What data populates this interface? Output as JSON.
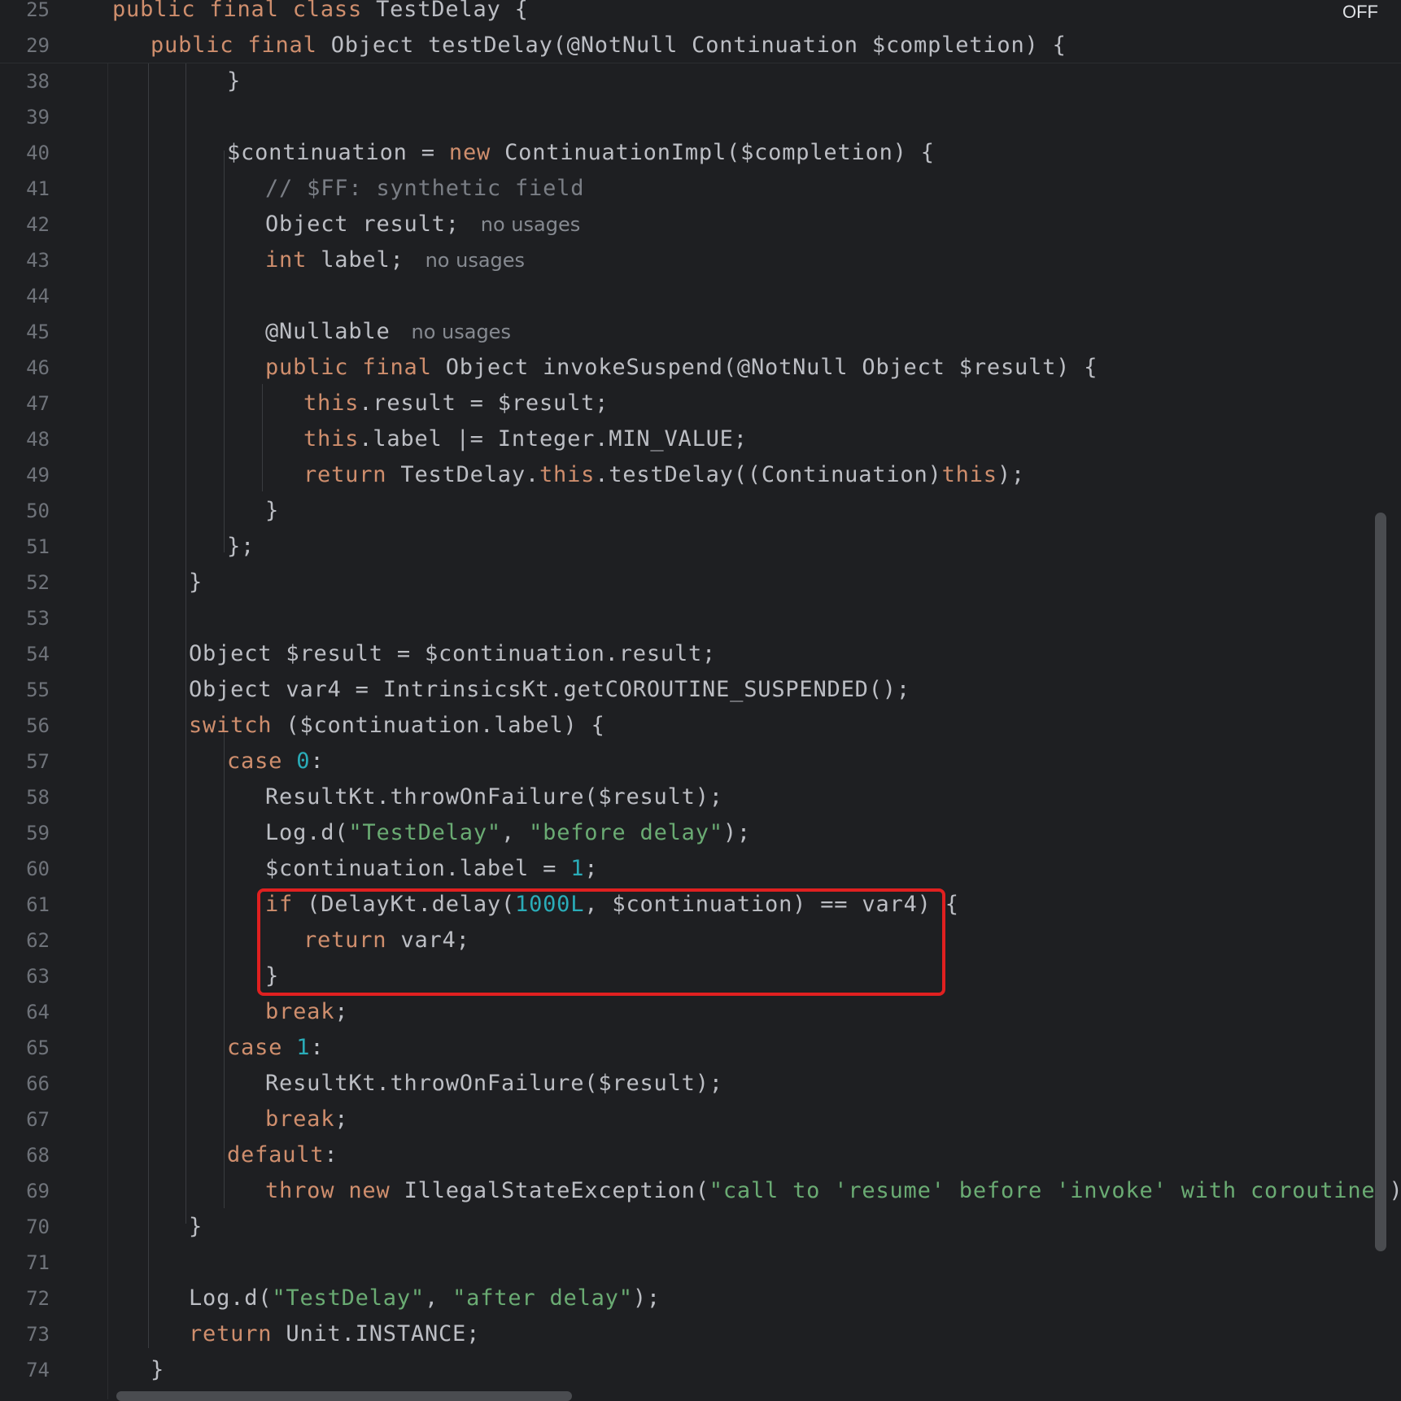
{
  "status_indicator": "OFF",
  "lines": [
    {
      "num": "25",
      "indent": 0,
      "tokens": [
        {
          "t": "public final class ",
          "c": "kw"
        },
        {
          "t": "TestDelay {",
          "c": "plain"
        }
      ]
    },
    {
      "num": "29",
      "indent": 1,
      "tokens": [
        {
          "t": "public final ",
          "c": "kw"
        },
        {
          "t": "Object testDelay(@NotNull Continuation $completion) {",
          "c": "plain"
        }
      ]
    },
    {
      "num": "38",
      "indent": 3,
      "tokens": [
        {
          "t": "}",
          "c": "plain"
        }
      ]
    },
    {
      "num": "39",
      "indent": 0,
      "tokens": []
    },
    {
      "num": "40",
      "indent": 3,
      "tokens": [
        {
          "t": "$continuation = ",
          "c": "plain"
        },
        {
          "t": "new ",
          "c": "kw"
        },
        {
          "t": "ContinuationImpl($completion) {",
          "c": "plain"
        }
      ]
    },
    {
      "num": "41",
      "indent": 4,
      "tokens": [
        {
          "t": "// $FF: synthetic field",
          "c": "cmt"
        }
      ]
    },
    {
      "num": "42",
      "indent": 4,
      "tokens": [
        {
          "t": "Object result;",
          "c": "plain"
        }
      ],
      "hint": "no usages"
    },
    {
      "num": "43",
      "indent": 4,
      "tokens": [
        {
          "t": "int ",
          "c": "kw"
        },
        {
          "t": "label;",
          "c": "plain"
        }
      ],
      "hint": "no usages"
    },
    {
      "num": "44",
      "indent": 0,
      "tokens": []
    },
    {
      "num": "45",
      "indent": 4,
      "tokens": [
        {
          "t": "@Nullable",
          "c": "plain"
        }
      ],
      "hint": "no usages"
    },
    {
      "num": "46",
      "indent": 4,
      "tokens": [
        {
          "t": "public final ",
          "c": "kw"
        },
        {
          "t": "Object invokeSuspend(@NotNull Object $result) {",
          "c": "plain"
        }
      ]
    },
    {
      "num": "47",
      "indent": 5,
      "tokens": [
        {
          "t": "this",
          "c": "kw"
        },
        {
          "t": ".result = $result;",
          "c": "plain"
        }
      ]
    },
    {
      "num": "48",
      "indent": 5,
      "tokens": [
        {
          "t": "this",
          "c": "kw"
        },
        {
          "t": ".label |= Integer.MIN_VALUE;",
          "c": "plain"
        }
      ]
    },
    {
      "num": "49",
      "indent": 5,
      "tokens": [
        {
          "t": "return ",
          "c": "kw"
        },
        {
          "t": "TestDelay.",
          "c": "plain"
        },
        {
          "t": "this",
          "c": "kw"
        },
        {
          "t": ".testDelay((Continuation)",
          "c": "plain"
        },
        {
          "t": "this",
          "c": "kw"
        },
        {
          "t": ");",
          "c": "plain"
        }
      ]
    },
    {
      "num": "50",
      "indent": 4,
      "tokens": [
        {
          "t": "}",
          "c": "plain"
        }
      ]
    },
    {
      "num": "51",
      "indent": 3,
      "tokens": [
        {
          "t": "};",
          "c": "plain"
        }
      ]
    },
    {
      "num": "52",
      "indent": 2,
      "tokens": [
        {
          "t": "}",
          "c": "plain"
        }
      ]
    },
    {
      "num": "53",
      "indent": 0,
      "tokens": []
    },
    {
      "num": "54",
      "indent": 2,
      "tokens": [
        {
          "t": "Object $result = $continuation.result;",
          "c": "plain"
        }
      ]
    },
    {
      "num": "55",
      "indent": 2,
      "tokens": [
        {
          "t": "Object var4 = IntrinsicsKt.getCOROUTINE_SUSPENDED();",
          "c": "plain"
        }
      ]
    },
    {
      "num": "56",
      "indent": 2,
      "tokens": [
        {
          "t": "switch ",
          "c": "kw"
        },
        {
          "t": "($continuation.label) {",
          "c": "plain"
        }
      ]
    },
    {
      "num": "57",
      "indent": 3,
      "tokens": [
        {
          "t": "case ",
          "c": "kw"
        },
        {
          "t": "0",
          "c": "num"
        },
        {
          "t": ":",
          "c": "plain"
        }
      ]
    },
    {
      "num": "58",
      "indent": 4,
      "tokens": [
        {
          "t": "ResultKt.throwOnFailure($result);",
          "c": "plain"
        }
      ]
    },
    {
      "num": "59",
      "indent": 4,
      "tokens": [
        {
          "t": "Log.d(",
          "c": "plain"
        },
        {
          "t": "\"TestDelay\"",
          "c": "str"
        },
        {
          "t": ", ",
          "c": "plain"
        },
        {
          "t": "\"before delay\"",
          "c": "str"
        },
        {
          "t": ");",
          "c": "plain"
        }
      ]
    },
    {
      "num": "60",
      "indent": 4,
      "tokens": [
        {
          "t": "$continuation.label = ",
          "c": "plain"
        },
        {
          "t": "1",
          "c": "num"
        },
        {
          "t": ";",
          "c": "plain"
        }
      ]
    },
    {
      "num": "61",
      "indent": 4,
      "tokens": [
        {
          "t": "if ",
          "c": "kw"
        },
        {
          "t": "(DelayKt.delay(",
          "c": "plain"
        },
        {
          "t": "1000L",
          "c": "num"
        },
        {
          "t": ", $continuation) == var4) {",
          "c": "plain"
        }
      ]
    },
    {
      "num": "62",
      "indent": 5,
      "tokens": [
        {
          "t": "return ",
          "c": "kw"
        },
        {
          "t": "var4;",
          "c": "plain"
        }
      ]
    },
    {
      "num": "63",
      "indent": 4,
      "tokens": [
        {
          "t": "}",
          "c": "plain"
        }
      ]
    },
    {
      "num": "64",
      "indent": 4,
      "tokens": [
        {
          "t": "break",
          "c": "kw"
        },
        {
          "t": ";",
          "c": "plain"
        }
      ]
    },
    {
      "num": "65",
      "indent": 3,
      "tokens": [
        {
          "t": "case ",
          "c": "kw"
        },
        {
          "t": "1",
          "c": "num"
        },
        {
          "t": ":",
          "c": "plain"
        }
      ]
    },
    {
      "num": "66",
      "indent": 4,
      "tokens": [
        {
          "t": "ResultKt.throwOnFailure($result);",
          "c": "plain"
        }
      ]
    },
    {
      "num": "67",
      "indent": 4,
      "tokens": [
        {
          "t": "break",
          "c": "kw"
        },
        {
          "t": ";",
          "c": "plain"
        }
      ]
    },
    {
      "num": "68",
      "indent": 3,
      "tokens": [
        {
          "t": "default",
          "c": "kw"
        },
        {
          "t": ":",
          "c": "plain"
        }
      ]
    },
    {
      "num": "69",
      "indent": 4,
      "tokens": [
        {
          "t": "throw new ",
          "c": "kw"
        },
        {
          "t": "IllegalStateException(",
          "c": "plain"
        },
        {
          "t": "\"call to 'resume' before 'invoke' with coroutine\"",
          "c": "str"
        },
        {
          "t": ");",
          "c": "plain"
        }
      ]
    },
    {
      "num": "70",
      "indent": 2,
      "tokens": [
        {
          "t": "}",
          "c": "plain"
        }
      ]
    },
    {
      "num": "71",
      "indent": 0,
      "tokens": []
    },
    {
      "num": "72",
      "indent": 2,
      "tokens": [
        {
          "t": "Log.d(",
          "c": "plain"
        },
        {
          "t": "\"TestDelay\"",
          "c": "str"
        },
        {
          "t": ", ",
          "c": "plain"
        },
        {
          "t": "\"after delay\"",
          "c": "str"
        },
        {
          "t": ");",
          "c": "plain"
        }
      ]
    },
    {
      "num": "73",
      "indent": 2,
      "tokens": [
        {
          "t": "return ",
          "c": "kw"
        },
        {
          "t": "Unit.INSTANCE;",
          "c": "plain"
        }
      ]
    },
    {
      "num": "74",
      "indent": 1,
      "tokens": [
        {
          "t": "}",
          "c": "plain"
        }
      ]
    }
  ]
}
